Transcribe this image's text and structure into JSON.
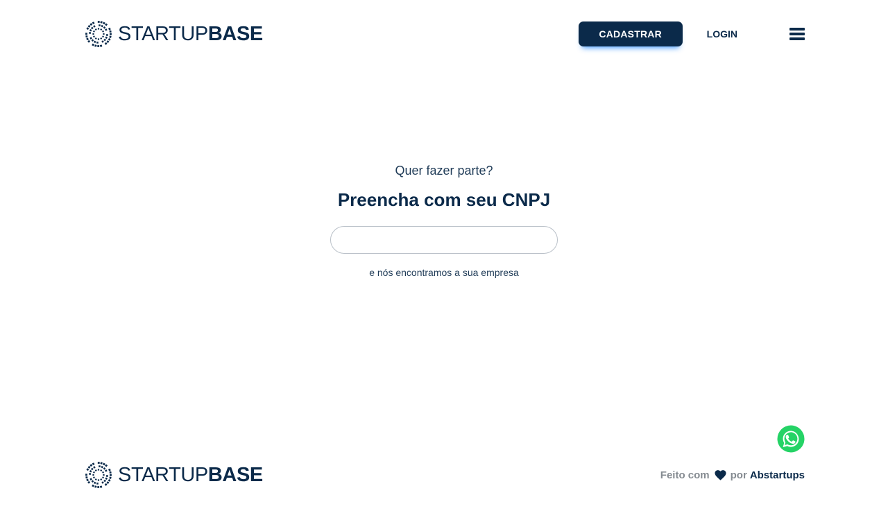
{
  "header": {
    "logo": {
      "name_light": "STARTUP",
      "name_bold": "BASE"
    },
    "register_label": "CADASTRAR",
    "login_label": "LOGIN",
    "menu_icon": "hamburger-menu-icon"
  },
  "main": {
    "subtitle": "Quer fazer parte?",
    "title": "Preencha com seu CNPJ",
    "cnpj_input": {
      "value": "",
      "placeholder": ""
    },
    "hint": "e nós encontramos a sua empresa"
  },
  "floating": {
    "whatsapp_icon": "whatsapp-icon",
    "whatsapp_color": "#25d366"
  },
  "footer": {
    "logo": {
      "name_light": "STARTUP",
      "name_bold": "BASE"
    },
    "made_with": "Feito com",
    "heart_icon": "heart-icon",
    "by": "por",
    "company": "Abstartups"
  },
  "colors": {
    "primary": "#0b2a4a",
    "muted": "#858b91",
    "input_border": "#b9c0c8"
  }
}
